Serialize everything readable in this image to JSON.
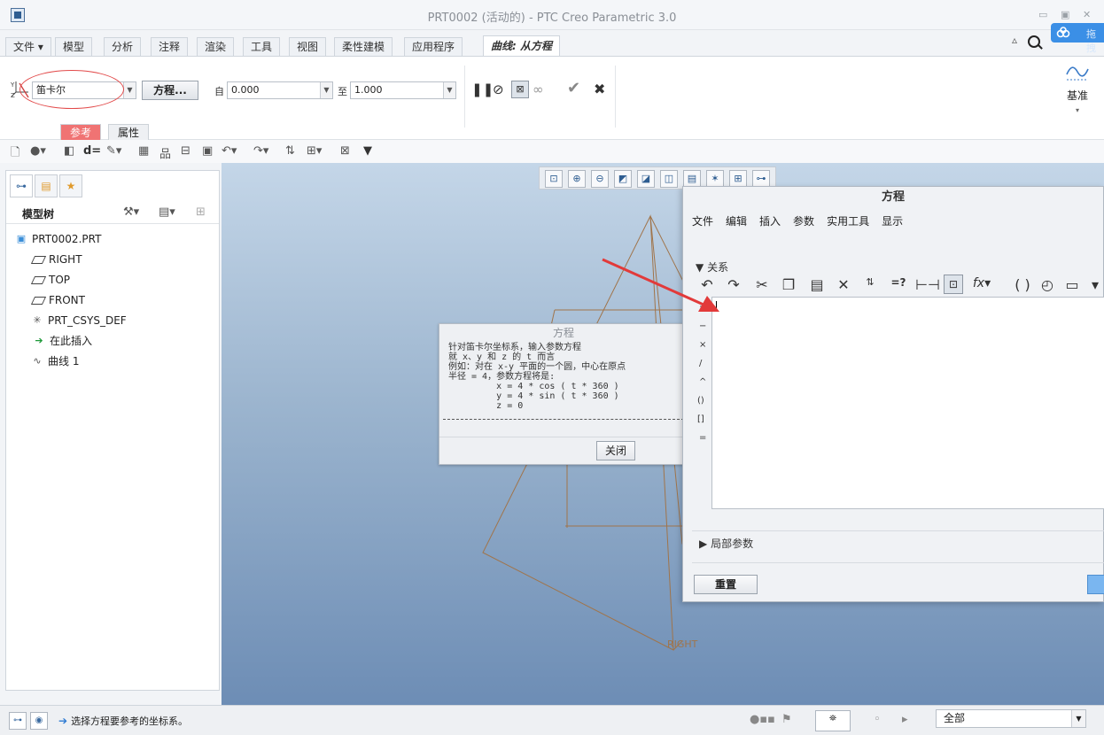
{
  "window": {
    "title": "PRT0002 (活动的) - PTC Creo Parametric 3.0",
    "cloud_label": "拖拽"
  },
  "ribbon_tabs": [
    {
      "label": "文件 ▾"
    },
    {
      "label": "模型"
    },
    {
      "label": "分析"
    },
    {
      "label": "注释"
    },
    {
      "label": "渲染"
    },
    {
      "label": "工具"
    },
    {
      "label": "视图"
    },
    {
      "label": "柔性建模"
    },
    {
      "label": "应用程序"
    },
    {
      "label": "曲线: 从方程"
    }
  ],
  "ribbon": {
    "coord_type": "笛卡尔",
    "equation_button": "方程...",
    "from_label": "自",
    "from_value": "0.000",
    "to_label": "至",
    "to_value": "1.000",
    "sub_tabs": [
      "参考",
      "属性"
    ],
    "datum_label": "基准"
  },
  "model_tree": {
    "header": "模型树",
    "items": [
      {
        "label": "PRT0002.PRT",
        "icon": "part-icon"
      },
      {
        "label": "RIGHT",
        "icon": "datum-plane-icon"
      },
      {
        "label": "TOP",
        "icon": "datum-plane-icon"
      },
      {
        "label": "FRONT",
        "icon": "datum-plane-icon"
      },
      {
        "label": "PRT_CSYS_DEF",
        "icon": "csys-icon"
      },
      {
        "label": "在此插入",
        "icon": "insert-here-icon"
      },
      {
        "label": "曲线 1",
        "icon": "curve-icon"
      }
    ]
  },
  "info_dialog": {
    "title": "方程",
    "lines": [
      "针对笛卡尔坐标系，输入参数方程",
      "就 x、y 和 z 的 t 而言",
      "例如：对在 x-y 平面的一个圆，中心在原点",
      "半径 = 4，参数方程将是:",
      "         x = 4 * cos ( t * 360 )",
      "         y = 4 * sin ( t * 360 )",
      "         z = 0"
    ],
    "close_button": "关闭"
  },
  "equation_dialog": {
    "title": "方程",
    "menu": [
      "文件",
      "编辑",
      "插入",
      "参数",
      "实用工具",
      "显示"
    ],
    "relations_section": "关系",
    "local_params_section": "局部参数",
    "side_operators": [
      "+",
      "−",
      "×",
      "/",
      "^",
      "()",
      "[]",
      "="
    ],
    "reset_button": "重置"
  },
  "graphics": {
    "right_label": "RIGHT"
  },
  "status": {
    "message": "选择方程要参考的坐标系。",
    "filter_value": "全部"
  },
  "colors": {
    "accent_red": "#e24a4a",
    "sketch_brown": "#a0744a",
    "active_subtab": "#f07373"
  }
}
